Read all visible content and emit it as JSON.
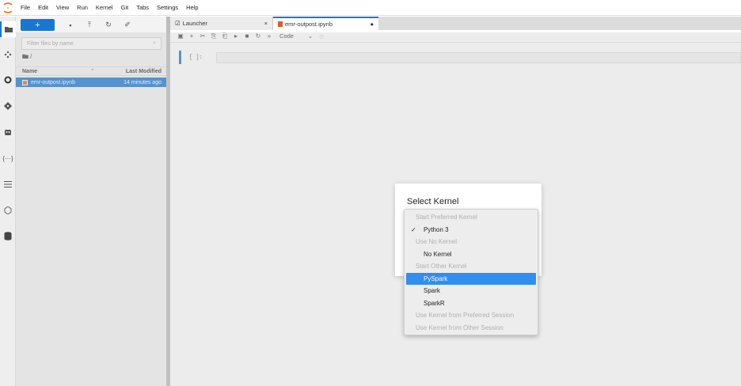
{
  "menubar": {
    "items": [
      "File",
      "Edit",
      "View",
      "Run",
      "Kernel",
      "Git",
      "Tabs",
      "Settings",
      "Help"
    ]
  },
  "activitybar": {
    "icons": [
      "folder-icon",
      "extension-puzzle-icon",
      "running-circle-icon",
      "git-icon",
      "robot-icon",
      "debugger-icon",
      "table-of-contents-icon",
      "property-inspector-icon",
      "database-icon"
    ]
  },
  "filebrowser": {
    "new_label": "+",
    "filter_placeholder": "Filter files by name",
    "breadcrumb": "/",
    "columns": {
      "name": "Name",
      "modified": "Last Modified"
    },
    "files": [
      {
        "name": "emr-outpost.ipynb",
        "modified": "14 minutes ago"
      }
    ]
  },
  "tabs": [
    {
      "label": "Launcher",
      "close": "×"
    },
    {
      "label": "emr-outpost.ipynb",
      "dirty": "●"
    }
  ],
  "notebook_toolbar": {
    "cell_type": "Code"
  },
  "cell": {
    "prompt": "[ ]:"
  },
  "dialog": {
    "title": "Select Kernel",
    "options": [
      {
        "label": "Start Preferred Kernel",
        "kind": "header"
      },
      {
        "label": "Python 3",
        "kind": "checked"
      },
      {
        "label": "Use No Kernel",
        "kind": "header"
      },
      {
        "label": "No Kernel",
        "kind": "option"
      },
      {
        "label": "Start Other Kernel",
        "kind": "header"
      },
      {
        "label": "PySpark",
        "kind": "selected"
      },
      {
        "label": "Spark",
        "kind": "option"
      },
      {
        "label": "SparkR",
        "kind": "option"
      },
      {
        "label": "Use Kernel from Preferred Session",
        "kind": "disabled"
      },
      {
        "label": "Use Kernel from Other Session",
        "kind": "disabled"
      }
    ]
  },
  "colors": {
    "accent": "#1976d2",
    "selection": "#2f8ef0",
    "notebook_icon": "#e05a2b"
  }
}
